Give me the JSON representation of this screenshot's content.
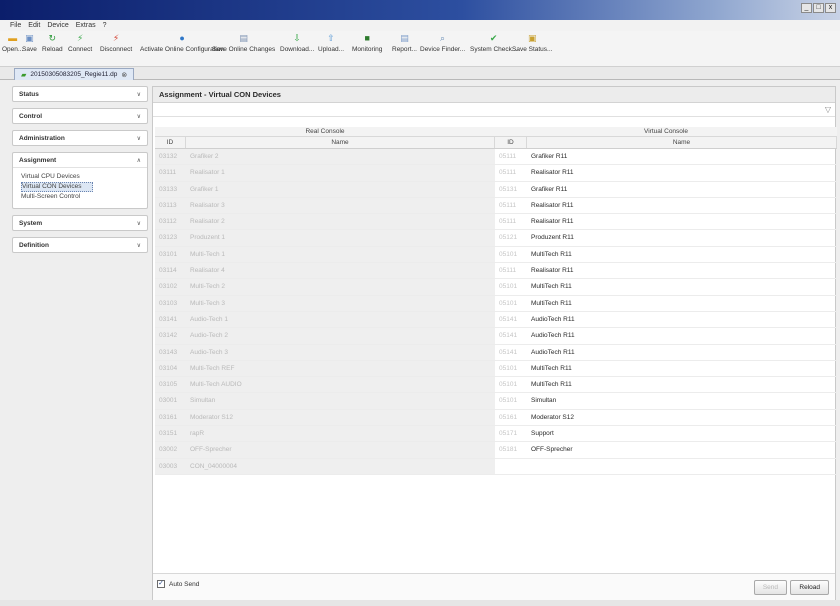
{
  "menu": [
    "File",
    "Edit",
    "Device",
    "Extras",
    "?"
  ],
  "window_controls": [
    "_",
    "□",
    "x"
  ],
  "toolbar": [
    {
      "label": "Open...",
      "icon": "folder-icon",
      "color": "#e0a020",
      "glyph": "▬"
    },
    {
      "label": "Save",
      "icon": "save-icon",
      "color": "#6b8fc4",
      "glyph": "▣"
    },
    {
      "label": "Reload",
      "icon": "reload-icon",
      "color": "#2c9a3a",
      "glyph": "↻"
    },
    {
      "label": "Connect",
      "icon": "connect-icon",
      "color": "#3aa84a",
      "glyph": "⚡"
    },
    {
      "label": "Disconnect",
      "icon": "disconnect-icon",
      "color": "#d23b2b",
      "glyph": "⚡"
    },
    {
      "label": "Activate Online Configuration",
      "icon": "activate-icon",
      "color": "#2f77c8",
      "glyph": "●"
    },
    {
      "label": "Save Online Changes",
      "icon": "save-changes-icon",
      "color": "#7a8fb0",
      "glyph": "▤"
    },
    {
      "label": "Download...",
      "icon": "download-icon",
      "color": "#3aa84a",
      "glyph": "⇩"
    },
    {
      "label": "Upload...",
      "icon": "upload-icon",
      "color": "#5a9ad6",
      "glyph": "⇧"
    },
    {
      "label": "Monitoring",
      "icon": "monitoring-icon",
      "color": "#2d7a2d",
      "glyph": "■"
    },
    {
      "label": "Report...",
      "icon": "report-icon",
      "color": "#7a9ac8",
      "glyph": "▤"
    },
    {
      "label": "Device Finder...",
      "icon": "device-finder-icon",
      "color": "#6b8fb8",
      "glyph": "⌕"
    },
    {
      "label": "System Check...",
      "icon": "system-check-icon",
      "color": "#3aa84a",
      "glyph": "✔"
    },
    {
      "label": "Save Status...",
      "icon": "save-status-icon",
      "color": "#c8a030",
      "glyph": "▣"
    }
  ],
  "file_tab": {
    "label": "20150305083205_Regie11.dp",
    "close": "⊗"
  },
  "sidebar": [
    {
      "title": "Status",
      "chev": "∨",
      "items": []
    },
    {
      "title": "Control",
      "chev": "∨",
      "items": []
    },
    {
      "title": "Administration",
      "chev": "∨",
      "items": []
    },
    {
      "title": "Assignment",
      "chev": "∧",
      "items": [
        {
          "label": "Virtual CPU Devices",
          "active": false
        },
        {
          "label": "Virtual CON Devices",
          "active": true
        },
        {
          "label": "Multi-Screen Control",
          "active": false
        }
      ]
    },
    {
      "title": "System",
      "chev": "∨",
      "items": []
    },
    {
      "title": "Definition",
      "chev": "∨",
      "items": []
    }
  ],
  "main": {
    "title": "Assignment - Virtual CON Devices",
    "filter_icon": "filter-icon",
    "groups": {
      "real": "Real Console",
      "virtual": "Virtual Console"
    },
    "columns": {
      "rid": "ID",
      "rname": "Name",
      "vid": "ID",
      "vname": "Name"
    },
    "rows": [
      {
        "rid": "03132",
        "rname": "Grafiker 2",
        "vid": "05111",
        "vname": "Grafiker R11"
      },
      {
        "rid": "03111",
        "rname": "Realisator 1",
        "vid": "05111",
        "vname": "Realisator R11"
      },
      {
        "rid": "03133",
        "rname": "Grafiker 1",
        "vid": "05131",
        "vname": "Grafiker R11"
      },
      {
        "rid": "03113",
        "rname": "Realisator 3",
        "vid": "05111",
        "vname": "Realisator R11"
      },
      {
        "rid": "03112",
        "rname": "Realisator 2",
        "vid": "05111",
        "vname": "Realisator R11"
      },
      {
        "rid": "03123",
        "rname": "Produzent 1",
        "vid": "05121",
        "vname": "Produzent R11"
      },
      {
        "rid": "03101",
        "rname": "Multi-Tech 1",
        "vid": "05101",
        "vname": "MultiTech R11"
      },
      {
        "rid": "03114",
        "rname": "Realisator 4",
        "vid": "05111",
        "vname": "Realisator R11"
      },
      {
        "rid": "03102",
        "rname": "Multi-Tech 2",
        "vid": "05101",
        "vname": "MultiTech R11"
      },
      {
        "rid": "03103",
        "rname": "Multi-Tech 3",
        "vid": "05101",
        "vname": "MultiTech R11"
      },
      {
        "rid": "03141",
        "rname": "Audio-Tech 1",
        "vid": "05141",
        "vname": "AudioTech R11"
      },
      {
        "rid": "03142",
        "rname": "Audio-Tech 2",
        "vid": "05141",
        "vname": "AudioTech R11"
      },
      {
        "rid": "03143",
        "rname": "Audio-Tech 3",
        "vid": "05141",
        "vname": "AudioTech R11"
      },
      {
        "rid": "03104",
        "rname": "Multi-Tech REF",
        "vid": "05101",
        "vname": "MultiTech R11"
      },
      {
        "rid": "03105",
        "rname": "Multi-Tech AUDIO",
        "vid": "05101",
        "vname": "MultiTech R11"
      },
      {
        "rid": "03001",
        "rname": "Simultan",
        "vid": "05101",
        "vname": "Simultan"
      },
      {
        "rid": "03161",
        "rname": "Moderator S12",
        "vid": "05161",
        "vname": "Moderator S12"
      },
      {
        "rid": "03151",
        "rname": "rapR",
        "vid": "05171",
        "vname": "Support"
      },
      {
        "rid": "03002",
        "rname": "OFF-Sprecher",
        "vid": "05181",
        "vname": "OFF-Sprecher"
      },
      {
        "rid": "03003",
        "rname": "CON_04000004",
        "vid": "",
        "vname": ""
      }
    ]
  },
  "footer": {
    "autosend_label": "Auto Send",
    "autosend_checked": "✓",
    "send_label": "Send",
    "reload_label": "Reload"
  }
}
